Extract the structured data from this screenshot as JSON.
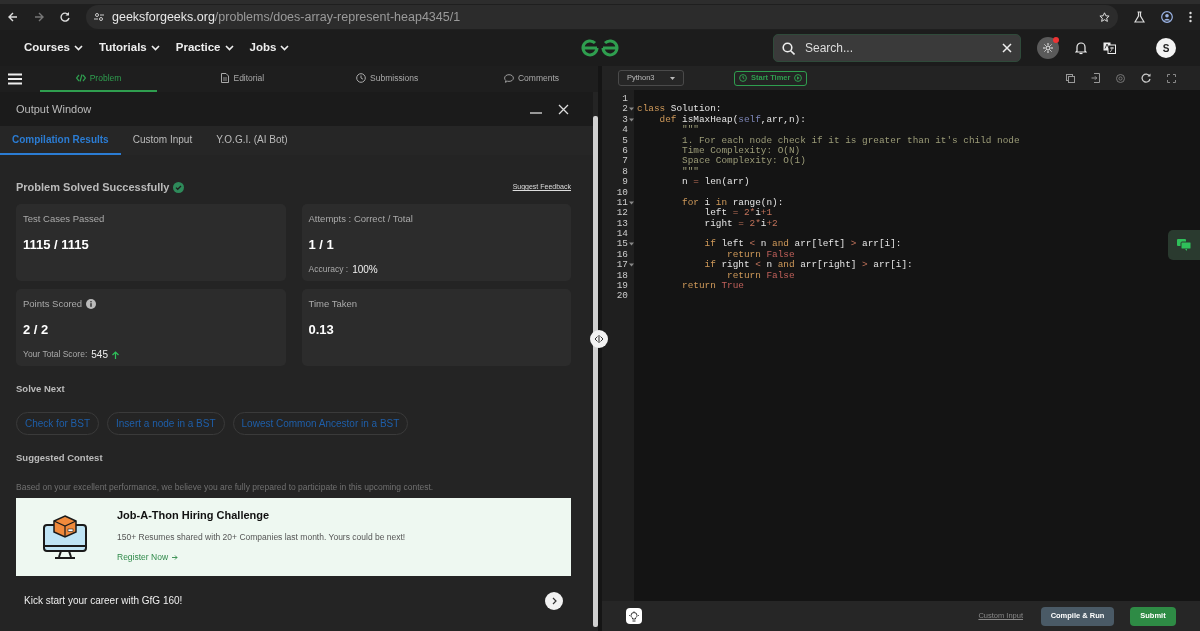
{
  "browser": {
    "url_host": "geeksforgeeks.org",
    "url_path": "/problems/does-array-represent-heap4345/1"
  },
  "site_nav": {
    "items": [
      "Courses",
      "Tutorials",
      "Practice",
      "Jobs"
    ],
    "search": {
      "placeholder": "Search..."
    },
    "theme_notification": true,
    "avatar": "S"
  },
  "problem_tabs": [
    {
      "label": "Problem",
      "kind": "code",
      "selected": true
    },
    {
      "label": "Editorial",
      "kind": "document",
      "selected": false
    },
    {
      "label": "Submissions",
      "kind": "clock",
      "selected": false
    },
    {
      "label": "Comments",
      "kind": "comment",
      "selected": false
    }
  ],
  "output_window": {
    "title": "Output Window",
    "tabs": [
      {
        "label": "Compilation Results",
        "selected": true
      },
      {
        "label": "Custom Input",
        "selected": false
      },
      {
        "label": "Y.O.G.I. (AI Bot)",
        "selected": false
      }
    ],
    "status": "Problem Solved Successfully",
    "feedback_link": "Suggest Feedback",
    "stats": [
      {
        "label": "Test Cases Passed",
        "value": "1115 / 1115"
      },
      {
        "label": "Attempts : Correct / Total",
        "value": "1 / 1",
        "detail_label": "Accuracy :",
        "detail_value": "100%"
      },
      {
        "label": "Points Scored",
        "info": true,
        "value": "2 / 2",
        "detail_label": "Your Total Score:",
        "detail_value": "545",
        "trend_up": true
      },
      {
        "label": "Time Taken",
        "value": "0.13"
      }
    ],
    "solve_next": {
      "title": "Solve Next",
      "items": [
        "Check for BST",
        "Insert a node in a BST",
        "Lowest Common Ancestor in a BST"
      ]
    },
    "suggested_contest": {
      "title": "Suggested Contest",
      "note": "Based on your excellent performance, we believe you are fully prepared to participate in this upcoming contest.",
      "card": {
        "title": "Job-A-Thon Hiring Challenge",
        "text": "150+ Resumes shared with 20+ Companies last month. Yours could be next!",
        "link": "Register Now"
      }
    },
    "footer_banner": "Kick start your career with GfG 160!"
  },
  "editor": {
    "language": "Python3",
    "timer_button": "Start Timer",
    "lines": [
      {
        "number": "1",
        "fold": false
      },
      {
        "number": "2",
        "fold": true,
        "tokens": [
          {
            "t": "class ",
            "kind": "kw"
          },
          {
            "t": "Solution:",
            "kind": "plain"
          }
        ]
      },
      {
        "number": "3",
        "fold": true,
        "tokens": [
          {
            "t": "    def ",
            "kind": "kw"
          },
          {
            "t": "isMaxHeap(",
            "kind": "plain"
          },
          {
            "t": "self",
            "kind": "self"
          },
          {
            "t": ",arr,n):",
            "kind": "plain"
          }
        ]
      },
      {
        "number": "4",
        "fold": false,
        "tokens": [
          {
            "t": "        \"\"\"",
            "kind": "str"
          }
        ]
      },
      {
        "number": "5",
        "fold": false,
        "tokens": [
          {
            "t": "        1. For each node check if it is greater than it's child node",
            "kind": "str"
          }
        ]
      },
      {
        "number": "6",
        "fold": false,
        "tokens": [
          {
            "t": "        Time Complexity: O(N)",
            "kind": "str"
          }
        ]
      },
      {
        "number": "7",
        "fold": false,
        "tokens": [
          {
            "t": "        Space Complexity: O(1)",
            "kind": "str"
          }
        ]
      },
      {
        "number": "8",
        "fold": false,
        "tokens": [
          {
            "t": "        \"\"\"",
            "kind": "str"
          }
        ]
      },
      {
        "number": "9",
        "fold": false,
        "tokens": [
          {
            "t": "        n ",
            "kind": "plain"
          },
          {
            "t": "=",
            "kind": "op"
          },
          {
            "t": " len(arr)",
            "kind": "plain"
          }
        ]
      },
      {
        "number": "10",
        "fold": false
      },
      {
        "number": "11",
        "fold": true,
        "tokens": [
          {
            "t": "        for ",
            "kind": "kw"
          },
          {
            "t": "i ",
            "kind": "plain"
          },
          {
            "t": "in ",
            "kind": "kw"
          },
          {
            "t": "range(n):",
            "kind": "plain"
          }
        ]
      },
      {
        "number": "12",
        "fold": false,
        "tokens": [
          {
            "t": "            left ",
            "kind": "plain"
          },
          {
            "t": "= ",
            "kind": "op"
          },
          {
            "t": "2",
            "kind": "num"
          },
          {
            "t": "*",
            "kind": "op"
          },
          {
            "t": "i",
            "kind": "plain"
          },
          {
            "t": "+1",
            "kind": "num"
          }
        ]
      },
      {
        "number": "13",
        "fold": false,
        "tokens": [
          {
            "t": "            right ",
            "kind": "plain"
          },
          {
            "t": "= ",
            "kind": "op"
          },
          {
            "t": "2",
            "kind": "num"
          },
          {
            "t": "*",
            "kind": "op"
          },
          {
            "t": "i",
            "kind": "plain"
          },
          {
            "t": "+2",
            "kind": "num"
          }
        ]
      },
      {
        "number": "14",
        "fold": false
      },
      {
        "number": "15",
        "fold": true,
        "tokens": [
          {
            "t": "            if ",
            "kind": "kw"
          },
          {
            "t": "left ",
            "kind": "plain"
          },
          {
            "t": "< ",
            "kind": "op"
          },
          {
            "t": "n ",
            "kind": "plain"
          },
          {
            "t": "and ",
            "kind": "kw"
          },
          {
            "t": "arr[left] ",
            "kind": "plain"
          },
          {
            "t": "> ",
            "kind": "op"
          },
          {
            "t": "arr[i]:",
            "kind": "plain"
          }
        ]
      },
      {
        "number": "16",
        "fold": false,
        "tokens": [
          {
            "t": "                return ",
            "kind": "kw"
          },
          {
            "t": "False",
            "kind": "const"
          }
        ]
      },
      {
        "number": "17",
        "fold": true,
        "tokens": [
          {
            "t": "            if ",
            "kind": "kw"
          },
          {
            "t": "right ",
            "kind": "plain"
          },
          {
            "t": "< ",
            "kind": "op"
          },
          {
            "t": "n ",
            "kind": "plain"
          },
          {
            "t": "and ",
            "kind": "kw"
          },
          {
            "t": "arr[right] ",
            "kind": "plain"
          },
          {
            "t": "> ",
            "kind": "op"
          },
          {
            "t": "arr[i]:",
            "kind": "plain"
          }
        ]
      },
      {
        "number": "18",
        "fold": false,
        "tokens": [
          {
            "t": "                return ",
            "kind": "kw"
          },
          {
            "t": "False",
            "kind": "const"
          }
        ]
      },
      {
        "number": "19",
        "fold": false,
        "tokens": [
          {
            "t": "        return ",
            "kind": "kw"
          },
          {
            "t": "True",
            "kind": "const"
          }
        ]
      },
      {
        "number": "20",
        "fold": false
      }
    ],
    "custom_input_link": "Custom Input",
    "compile_button": "Compile & Run",
    "submit_button": "Submit"
  }
}
